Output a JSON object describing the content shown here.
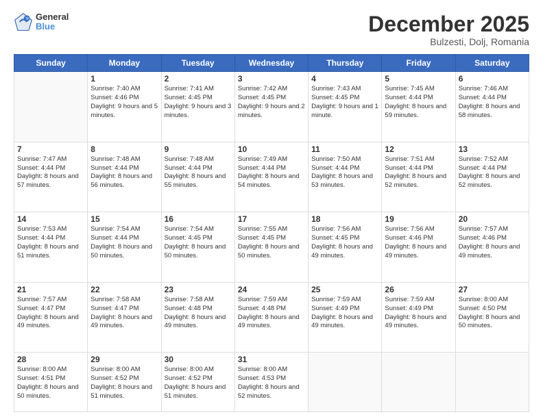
{
  "header": {
    "logo": {
      "line1": "General",
      "line2": "Blue"
    },
    "title": "December 2025",
    "subtitle": "Bulzesti, Dolj, Romania"
  },
  "days_of_week": [
    "Sunday",
    "Monday",
    "Tuesday",
    "Wednesday",
    "Thursday",
    "Friday",
    "Saturday"
  ],
  "weeks": [
    [
      {
        "day": "",
        "empty": true
      },
      {
        "day": "1",
        "sunrise": "Sunrise: 7:40 AM",
        "sunset": "Sunset: 4:46 PM",
        "daylight": "Daylight: 9 hours and 5 minutes."
      },
      {
        "day": "2",
        "sunrise": "Sunrise: 7:41 AM",
        "sunset": "Sunset: 4:45 PM",
        "daylight": "Daylight: 9 hours and 3 minutes."
      },
      {
        "day": "3",
        "sunrise": "Sunrise: 7:42 AM",
        "sunset": "Sunset: 4:45 PM",
        "daylight": "Daylight: 9 hours and 2 minutes."
      },
      {
        "day": "4",
        "sunrise": "Sunrise: 7:43 AM",
        "sunset": "Sunset: 4:45 PM",
        "daylight": "Daylight: 9 hours and 1 minute."
      },
      {
        "day": "5",
        "sunrise": "Sunrise: 7:45 AM",
        "sunset": "Sunset: 4:44 PM",
        "daylight": "Daylight: 8 hours and 59 minutes."
      },
      {
        "day": "6",
        "sunrise": "Sunrise: 7:46 AM",
        "sunset": "Sunset: 4:44 PM",
        "daylight": "Daylight: 8 hours and 58 minutes."
      }
    ],
    [
      {
        "day": "7",
        "sunrise": "Sunrise: 7:47 AM",
        "sunset": "Sunset: 4:44 PM",
        "daylight": "Daylight: 8 hours and 57 minutes."
      },
      {
        "day": "8",
        "sunrise": "Sunrise: 7:48 AM",
        "sunset": "Sunset: 4:44 PM",
        "daylight": "Daylight: 8 hours and 56 minutes."
      },
      {
        "day": "9",
        "sunrise": "Sunrise: 7:48 AM",
        "sunset": "Sunset: 4:44 PM",
        "daylight": "Daylight: 8 hours and 55 minutes."
      },
      {
        "day": "10",
        "sunrise": "Sunrise: 7:49 AM",
        "sunset": "Sunset: 4:44 PM",
        "daylight": "Daylight: 8 hours and 54 minutes."
      },
      {
        "day": "11",
        "sunrise": "Sunrise: 7:50 AM",
        "sunset": "Sunset: 4:44 PM",
        "daylight": "Daylight: 8 hours and 53 minutes."
      },
      {
        "day": "12",
        "sunrise": "Sunrise: 7:51 AM",
        "sunset": "Sunset: 4:44 PM",
        "daylight": "Daylight: 8 hours and 52 minutes."
      },
      {
        "day": "13",
        "sunrise": "Sunrise: 7:52 AM",
        "sunset": "Sunset: 4:44 PM",
        "daylight": "Daylight: 8 hours and 52 minutes."
      }
    ],
    [
      {
        "day": "14",
        "sunrise": "Sunrise: 7:53 AM",
        "sunset": "Sunset: 4:44 PM",
        "daylight": "Daylight: 8 hours and 51 minutes."
      },
      {
        "day": "15",
        "sunrise": "Sunrise: 7:54 AM",
        "sunset": "Sunset: 4:44 PM",
        "daylight": "Daylight: 8 hours and 50 minutes."
      },
      {
        "day": "16",
        "sunrise": "Sunrise: 7:54 AM",
        "sunset": "Sunset: 4:45 PM",
        "daylight": "Daylight: 8 hours and 50 minutes."
      },
      {
        "day": "17",
        "sunrise": "Sunrise: 7:55 AM",
        "sunset": "Sunset: 4:45 PM",
        "daylight": "Daylight: 8 hours and 50 minutes."
      },
      {
        "day": "18",
        "sunrise": "Sunrise: 7:56 AM",
        "sunset": "Sunset: 4:45 PM",
        "daylight": "Daylight: 8 hours and 49 minutes."
      },
      {
        "day": "19",
        "sunrise": "Sunrise: 7:56 AM",
        "sunset": "Sunset: 4:46 PM",
        "daylight": "Daylight: 8 hours and 49 minutes."
      },
      {
        "day": "20",
        "sunrise": "Sunrise: 7:57 AM",
        "sunset": "Sunset: 4:46 PM",
        "daylight": "Daylight: 8 hours and 49 minutes."
      }
    ],
    [
      {
        "day": "21",
        "sunrise": "Sunrise: 7:57 AM",
        "sunset": "Sunset: 4:47 PM",
        "daylight": "Daylight: 8 hours and 49 minutes."
      },
      {
        "day": "22",
        "sunrise": "Sunrise: 7:58 AM",
        "sunset": "Sunset: 4:47 PM",
        "daylight": "Daylight: 8 hours and 49 minutes."
      },
      {
        "day": "23",
        "sunrise": "Sunrise: 7:58 AM",
        "sunset": "Sunset: 4:48 PM",
        "daylight": "Daylight: 8 hours and 49 minutes."
      },
      {
        "day": "24",
        "sunrise": "Sunrise: 7:59 AM",
        "sunset": "Sunset: 4:48 PM",
        "daylight": "Daylight: 8 hours and 49 minutes."
      },
      {
        "day": "25",
        "sunrise": "Sunrise: 7:59 AM",
        "sunset": "Sunset: 4:49 PM",
        "daylight": "Daylight: 8 hours and 49 minutes."
      },
      {
        "day": "26",
        "sunrise": "Sunrise: 7:59 AM",
        "sunset": "Sunset: 4:49 PM",
        "daylight": "Daylight: 8 hours and 49 minutes."
      },
      {
        "day": "27",
        "sunrise": "Sunrise: 8:00 AM",
        "sunset": "Sunset: 4:50 PM",
        "daylight": "Daylight: 8 hours and 50 minutes."
      }
    ],
    [
      {
        "day": "28",
        "sunrise": "Sunrise: 8:00 AM",
        "sunset": "Sunset: 4:51 PM",
        "daylight": "Daylight: 8 hours and 50 minutes."
      },
      {
        "day": "29",
        "sunrise": "Sunrise: 8:00 AM",
        "sunset": "Sunset: 4:52 PM",
        "daylight": "Daylight: 8 hours and 51 minutes."
      },
      {
        "day": "30",
        "sunrise": "Sunrise: 8:00 AM",
        "sunset": "Sunset: 4:52 PM",
        "daylight": "Daylight: 8 hours and 51 minutes."
      },
      {
        "day": "31",
        "sunrise": "Sunrise: 8:00 AM",
        "sunset": "Sunset: 4:53 PM",
        "daylight": "Daylight: 8 hours and 52 minutes."
      },
      {
        "day": "",
        "empty": true
      },
      {
        "day": "",
        "empty": true
      },
      {
        "day": "",
        "empty": true
      }
    ]
  ]
}
